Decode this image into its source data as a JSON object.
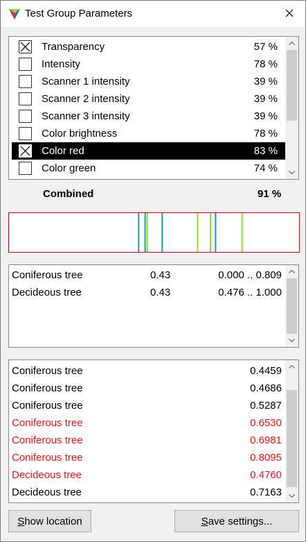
{
  "window": {
    "title": "Test Group Parameters"
  },
  "parameters": [
    {
      "label": "Transparency",
      "value": "57 %",
      "checked": true,
      "selected": false
    },
    {
      "label": "Intensity",
      "value": "78 %",
      "checked": false,
      "selected": false
    },
    {
      "label": "Scanner 1 intensity",
      "value": "39 %",
      "checked": false,
      "selected": false
    },
    {
      "label": "Scanner 2 intensity",
      "value": "39 %",
      "checked": false,
      "selected": false
    },
    {
      "label": "Scanner 3 intensity",
      "value": "39 %",
      "checked": false,
      "selected": false
    },
    {
      "label": "Color brightness",
      "value": "78 %",
      "checked": false,
      "selected": false
    },
    {
      "label": "Color red",
      "value": "83 %",
      "checked": true,
      "selected": true
    },
    {
      "label": "Color green",
      "value": "74 %",
      "checked": false,
      "selected": false
    }
  ],
  "combined": {
    "label": "Combined",
    "value": "91 %"
  },
  "strip_colors": {
    "teal": "#1e9aa6",
    "green": "#7ee620",
    "border": "#a01818"
  },
  "class_ranges": [
    {
      "name": "Coniferous tree",
      "weight": "0.43",
      "range": "0.000 .. 0.809"
    },
    {
      "name": "Decideous tree",
      "weight": "0.43",
      "range": "0.476 .. 1.000"
    }
  ],
  "points": [
    {
      "name": "Coniferous tree",
      "value": "0.4459",
      "highlight": false
    },
    {
      "name": "Coniferous tree",
      "value": "0.4686",
      "highlight": false
    },
    {
      "name": "Coniferous tree",
      "value": "0.5287",
      "highlight": false
    },
    {
      "name": "Coniferous tree",
      "value": "0.6530",
      "highlight": true
    },
    {
      "name": "Coniferous tree",
      "value": "0.6981",
      "highlight": true
    },
    {
      "name": "Coniferous tree",
      "value": "0.8095",
      "highlight": true
    },
    {
      "name": "Decideous tree",
      "value": "0.4760",
      "highlight": true
    },
    {
      "name": "Decideous tree",
      "value": "0.7163",
      "highlight": false
    }
  ],
  "highlight_color": "#e8141b",
  "buttons": {
    "show_location_accel": "S",
    "show_location_rest": "how location",
    "save_settings_accel": "S",
    "save_settings_rest": "ave settings..."
  }
}
